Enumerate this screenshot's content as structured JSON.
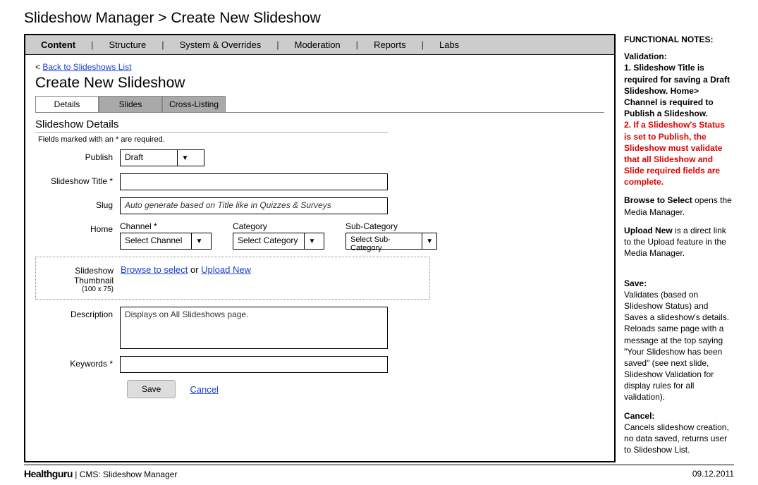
{
  "breadcrumb": "Slideshow Manager > Create New Slideshow",
  "nav": {
    "items": [
      "Content",
      "Structure",
      "System & Overrides",
      "Moderation",
      "Reports",
      "Labs"
    ]
  },
  "back_link_prefix": "< ",
  "back_link": "Back to Slideshows List",
  "page_title": "Create New Slideshow",
  "tabs": [
    "Details",
    "Slides",
    "Cross-Listing"
  ],
  "section_title": "Slideshow Details",
  "required_note": "Fields marked with an * are required.",
  "form": {
    "publish_label": "Publish",
    "publish_value": "Draft",
    "title_label": "Slideshow Title *",
    "title_value": "",
    "slug_label": "Slug",
    "slug_placeholder": "Auto generate based on Title like in Quizzes & Surveys",
    "home_label": "Home",
    "channel_label": "Channel *",
    "channel_value": "Select Channel",
    "category_label": "Category",
    "category_value": "Select Category",
    "subcat_label": "Sub-Category",
    "subcat_value": "Select Sub-Category",
    "thumb_label": "Slideshow Thumbnail",
    "thumb_sub": "(100 x 75)",
    "browse_link": "Browse to select",
    "or_text": "  or ",
    "upload_link": "Upload New",
    "desc_label": "Description",
    "desc_placeholder": "Displays on All Slideshows page.",
    "keywords_label": "Keywords *",
    "save_btn": "Save",
    "cancel_link": "Cancel"
  },
  "notes": {
    "title": "FUNCTIONAL NOTES:",
    "validation_h": "Validation:",
    "validation_1": "1. Slideshow Title is required for saving a Draft Slideshow. Home> Channel is required to Publish a Slideshow.",
    "validation_2": "2. If a Slideshow's Status is set to Publish, the Slideshow must validate that all Slideshow and Slide required fields are complete.",
    "browse_b": "Browse to Select",
    "browse_t": " opens the Media Manager.",
    "upload_b": "Upload New",
    "upload_t": " is a direct link to the Upload feature in the Media Manager.",
    "save_h": "Save:",
    "save_t": "Validates (based on Slideshow Status) and Saves a slideshow's details.  Reloads same page with a message at the top saying \"Your Slideshow has been saved\" (see next slide, Slideshow Validation for display rules for all validation).",
    "cancel_h": "Cancel:",
    "cancel_t": "Cancels slideshow creation, no data saved, returns user to Slideshow List."
  },
  "footer": {
    "logo_h": "H",
    "logo_rest": "ealthguru",
    "sep": "   |   ",
    "subtitle": "CMS: Slideshow Manager",
    "date": "09.12.2011"
  }
}
